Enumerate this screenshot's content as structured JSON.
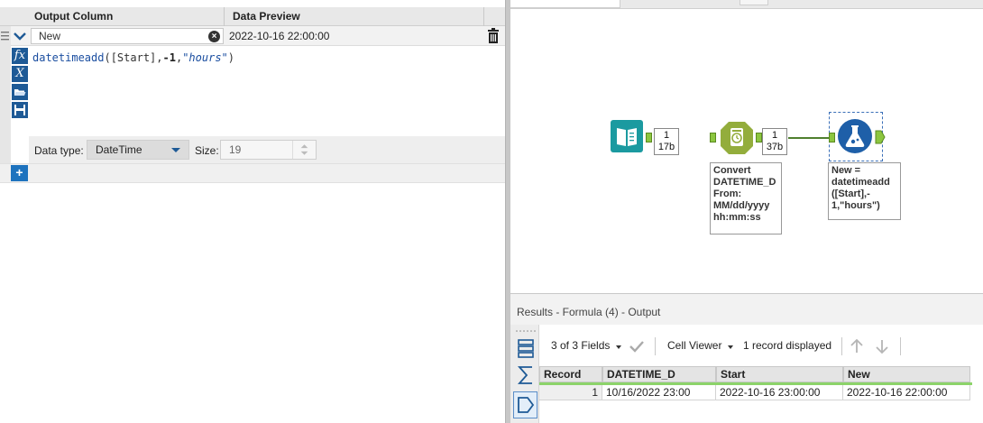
{
  "formula_panel": {
    "headers": {
      "output_column": "Output Column",
      "data_preview": "Data Preview"
    },
    "field_value": "New",
    "preview_value": "2022-10-16 22:00:00",
    "expression": {
      "fn": "datetimeadd",
      "open": "([Start],",
      "num": "-1",
      "comma": ",",
      "str": "\"hours\"",
      "close": ")"
    },
    "data_type_label": "Data type:",
    "data_type_value": "DateTime",
    "size_label": "Size:",
    "size_value": "19",
    "side_icons": [
      "fx",
      "X"
    ]
  },
  "canvas": {
    "badge1": {
      "line1": "1",
      "line2": "17b"
    },
    "badge2": {
      "line1": "1",
      "line2": "37b"
    },
    "annot_convert": [
      "Convert",
      "DATETIME_D",
      "From:",
      "MM/dd/yyyy",
      "hh:mm:ss"
    ],
    "annot_formula": [
      "New =",
      "datetimeadd",
      "([Start],-",
      "1,\"hours\")"
    ]
  },
  "results": {
    "title": "Results - Formula (4) - Output",
    "fields_label": "3 of 3 Fields",
    "cell_viewer_label": "Cell Viewer",
    "records_displayed": "1 record displayed",
    "columns": [
      "Record",
      "DATETIME_D",
      "Start",
      "New"
    ],
    "rows": [
      {
        "record": "1",
        "datetime_d": "10/16/2022 23:00",
        "start": "2022-10-16 23:00:00",
        "new": "2022-10-16 22:00:00"
      }
    ]
  },
  "colors": {
    "accent": "#1e5a96",
    "anchor_green": "#8cc63f",
    "connection": "#4f7f2f"
  }
}
